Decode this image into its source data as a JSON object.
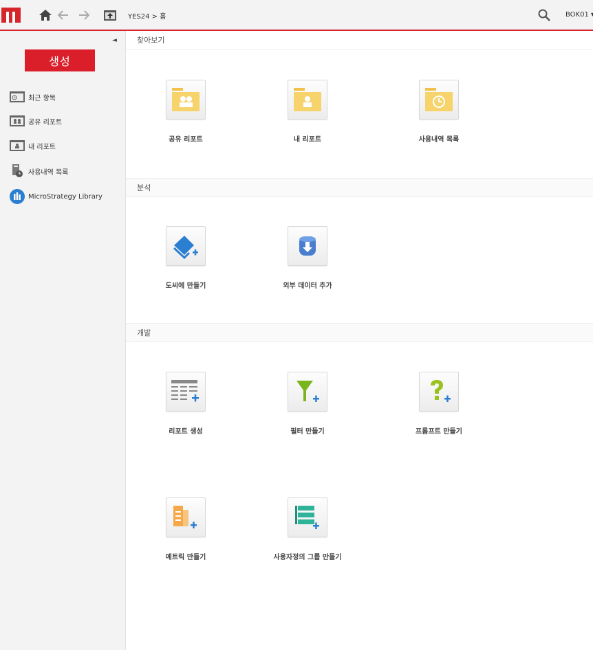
{
  "header": {
    "breadcrumb": "YES24 > 홈",
    "user": "BOK01 ▾"
  },
  "sidebar": {
    "collapse": "◄",
    "create_label": "생성",
    "items": [
      {
        "label": "최근 항목",
        "icon": "recent-folder-icon"
      },
      {
        "label": "공유 리포트",
        "icon": "shared-folder-icon"
      },
      {
        "label": "내 리포트",
        "icon": "my-folder-icon"
      },
      {
        "label": "사용내역 목록",
        "icon": "history-list-icon"
      },
      {
        "label": "MicroStrategy Library",
        "icon": "library-icon"
      }
    ]
  },
  "sections": [
    {
      "title": "찾아보기"
    },
    {
      "title": "분석"
    },
    {
      "title": "개발"
    }
  ],
  "tiles": {
    "browse": [
      {
        "label": "공유 리포트",
        "icon": "shared-reports-folder-icon"
      },
      {
        "label": "내 리포트",
        "icon": "my-reports-folder-icon"
      },
      {
        "label": "사용내역 목록",
        "icon": "history-folder-icon"
      }
    ],
    "analysis": [
      {
        "label": "도씨에 만들기",
        "icon": "create-dossier-icon"
      },
      {
        "label": "외부 데이터 추가",
        "icon": "add-external-data-icon"
      }
    ],
    "develop": [
      {
        "label": "리포트 생성",
        "icon": "create-report-icon"
      },
      {
        "label": "필터 만들기",
        "icon": "create-filter-icon"
      },
      {
        "label": "프롬프트 만들기",
        "icon": "create-prompt-icon"
      },
      {
        "label": "메트릭 만들기",
        "icon": "create-metric-icon"
      },
      {
        "label": "사용자정의 그룹 만들기",
        "icon": "create-custom-group-icon"
      }
    ]
  },
  "colors": {
    "accent": "#db1f2a",
    "folder": "#f6d36b",
    "blue": "#2b7fd0",
    "green": "#7ab51d"
  }
}
